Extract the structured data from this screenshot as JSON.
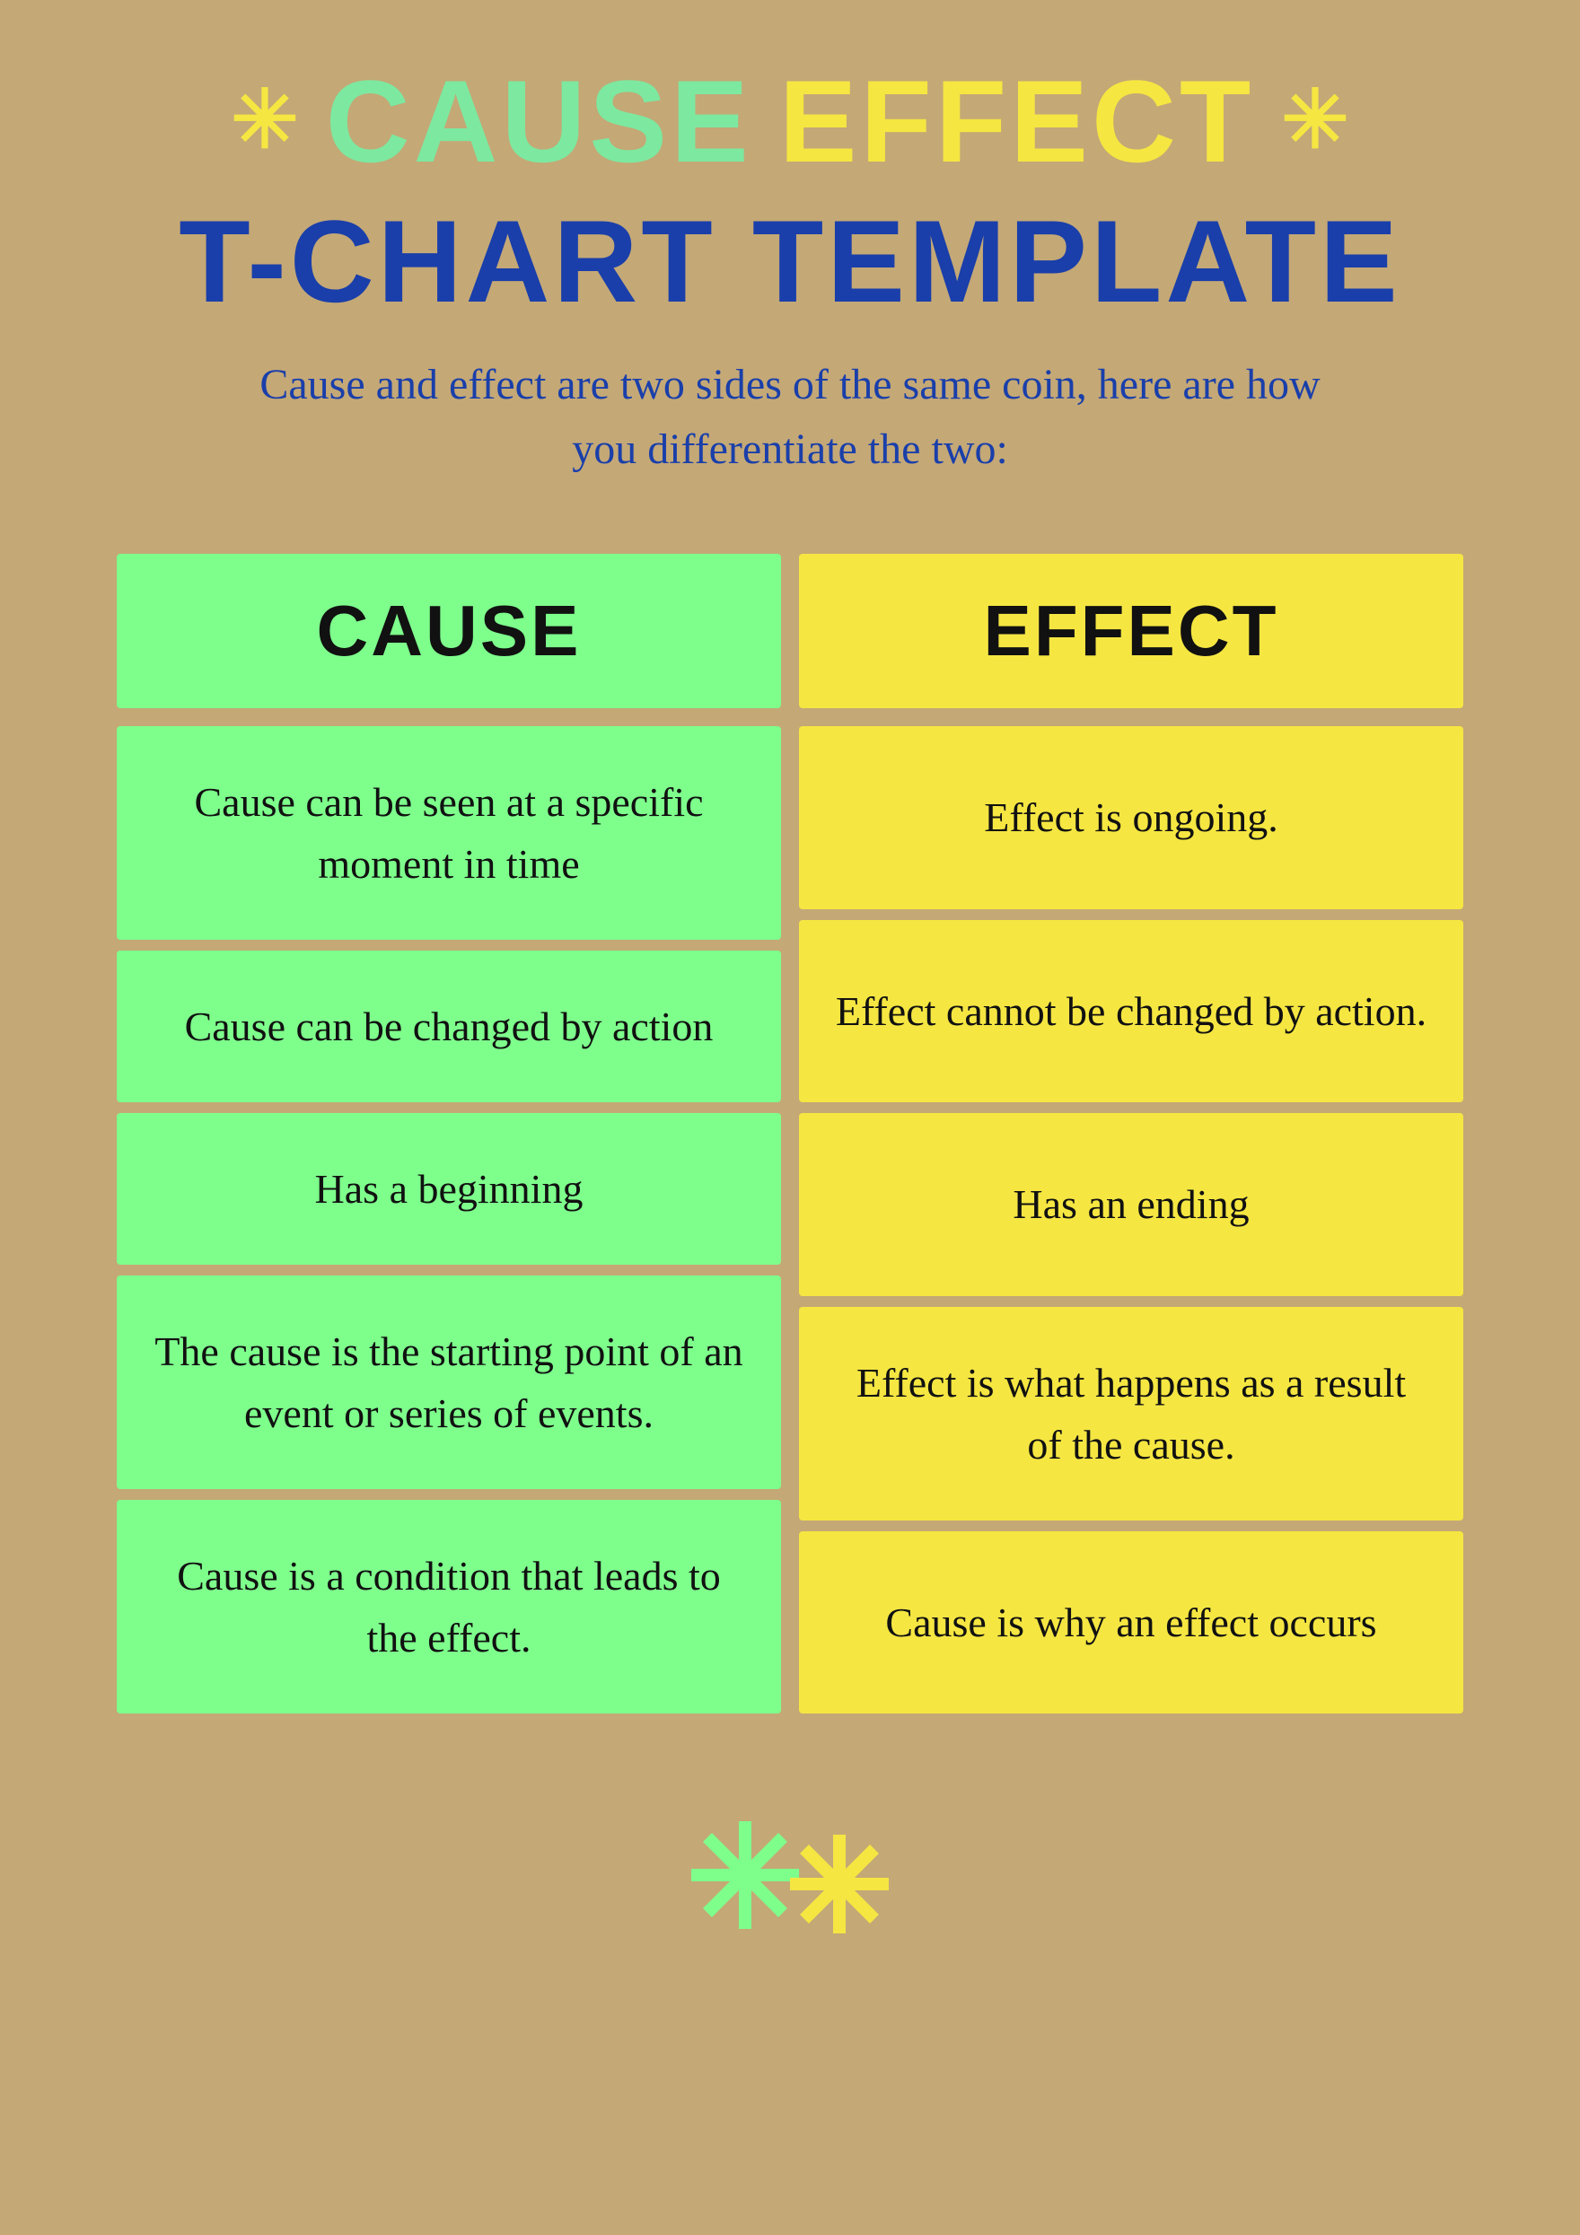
{
  "header": {
    "title_cause": "CAUSE",
    "title_effect": "EFFECT",
    "title_line2": "T-CHART TEMPLATE",
    "subtitle": "Cause and effect are two sides of the same coin, here are how you differentiate the two:"
  },
  "columns": {
    "cause_header": "CAUSE",
    "effect_header": "EFFECT"
  },
  "rows": [
    {
      "cause": "Cause can be seen at a specific moment in time",
      "effect": "Effect is ongoing."
    },
    {
      "cause": "Cause can be changed by action",
      "effect": "Effect cannot be changed by action."
    },
    {
      "cause": "Has a beginning",
      "effect": "Has an ending"
    },
    {
      "cause": "The cause is the starting point of an event or series of events.",
      "effect": "Effect is what happens as a result of the cause."
    },
    {
      "cause": "Cause is a condition that leads to the effect.",
      "effect": "Cause is why an effect occurs"
    }
  ]
}
